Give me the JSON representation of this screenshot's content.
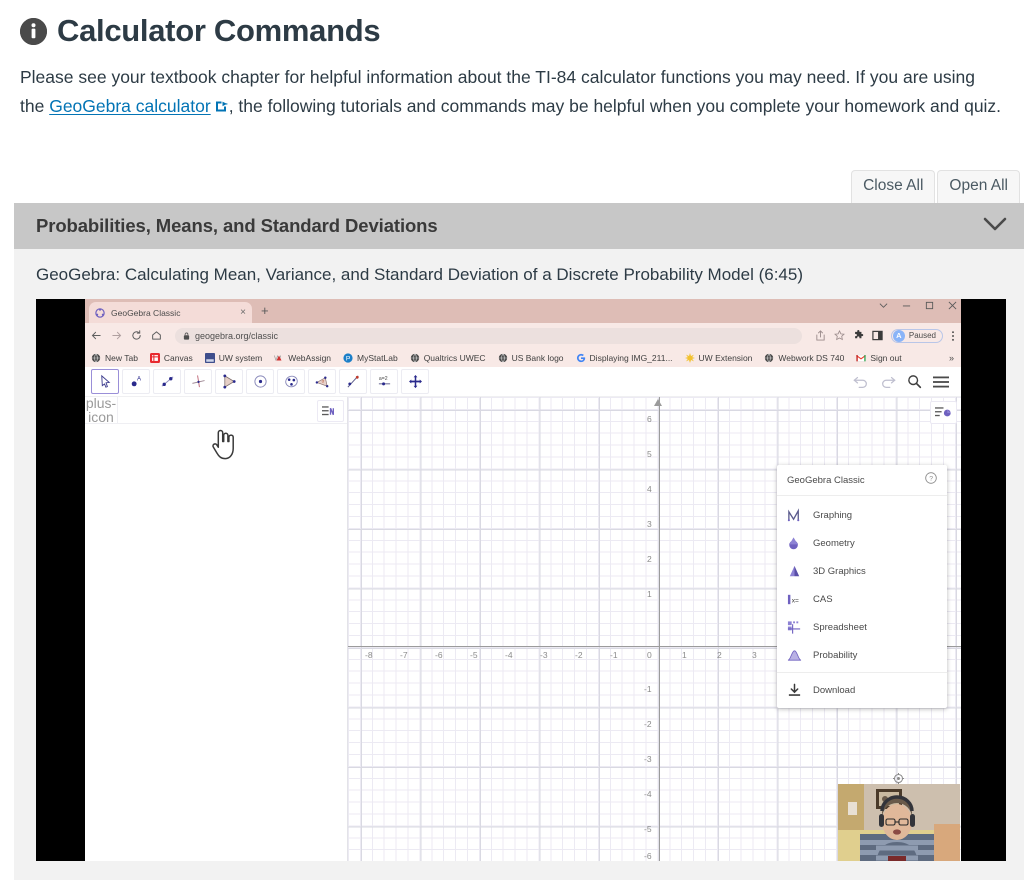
{
  "header": {
    "icon": "info-circle-icon",
    "title": "Calculator Commands",
    "intro_before_link": "Please see your textbook chapter for helpful information about the TI-84 calculator functions you may need. If you are using the ",
    "link_text": "GeoGebra calculator",
    "link_icon": "external-link-icon",
    "intro_after_link": ", the following tutorials and commands may be helpful when you complete your homework and quiz."
  },
  "toolbar": {
    "close_all_label": "Close All",
    "open_all_label": "Open All"
  },
  "accordion": {
    "title": "Probabilities, Means, and Standard Deviations",
    "chevron": "chevron-down-icon",
    "expanded": true,
    "caption": "GeoGebra: Calculating Mean, Variance, and Standard Deviation of a Discrete Probability Model (6:45)",
    "duration": "6:45"
  },
  "video": {
    "browser": {
      "tab_title": "GeoGebra Classic",
      "tab_favicon": "geogebra-icon",
      "tab_close": "close-icon",
      "new_tab": "+",
      "window_controls": [
        "chevron-down-icon",
        "minimize-icon",
        "maximize-icon",
        "close-icon"
      ],
      "nav": {
        "back": "back-arrow-icon",
        "forward": "forward-arrow-icon",
        "reload": "reload-icon",
        "home": "home-icon"
      },
      "omnibox": {
        "lock_icon": "lock-icon",
        "url": "geogebra.org/classic"
      },
      "right_icons": [
        "share-icon",
        "star-icon",
        "extensions-puzzle-icon",
        "sidepanel-icon"
      ],
      "profile": {
        "initial": "A",
        "status": "Paused"
      },
      "menu_icon": "three-dot-menu-icon",
      "bookmarks": [
        {
          "label": "New Tab",
          "icon": "globe-icon"
        },
        {
          "label": "Canvas",
          "icon": "canvas-icon"
        },
        {
          "label": "UW system",
          "icon": "uw-icon"
        },
        {
          "label": "WebAssign",
          "icon": "webassign-icon"
        },
        {
          "label": "MyStatLab",
          "icon": "mystatlab-icon"
        },
        {
          "label": "Qualtrics UWEC",
          "icon": "globe-icon"
        },
        {
          "label": "US Bank logo",
          "icon": "globe-icon"
        },
        {
          "label": "Displaying IMG_211...",
          "icon": "google-icon"
        },
        {
          "label": "UW Extension",
          "icon": "star-burst-icon"
        },
        {
          "label": "Webwork DS 740",
          "icon": "globe-icon"
        },
        {
          "label": "Sign out",
          "icon": "gmail-icon"
        }
      ],
      "bookmarks_overflow": "»"
    },
    "geogebra": {
      "tools": [
        "move-tool-icon",
        "point-tool-icon",
        "line-tool-icon",
        "perpendicular-line-tool-icon",
        "polygon-tool-icon",
        "circle-tool-icon",
        "ellipse-tool-icon",
        "angle-tool-icon",
        "reflect-tool-icon",
        "slider-tool-icon",
        "move-graphics-tool-icon"
      ],
      "tool_right_icons": [
        "undo-icon",
        "redo-icon",
        "search-icon",
        "hamburger-menu-icon"
      ],
      "algebra_panel": {
        "add_icon": "plus-icon",
        "toggle_icon": "algebra-view-icon",
        "cursor": "pointing-hand-cursor"
      },
      "graphics": {
        "style_bar_icon": "style-bar-icon",
        "x_ticks": [
          "-8",
          "-7",
          "-6",
          "-5",
          "-4",
          "-3",
          "-2",
          "-1",
          "0",
          "1",
          "2",
          "3"
        ],
        "y_ticks": [
          "6",
          "5",
          "4",
          "3",
          "2",
          "1",
          "-1",
          "-2",
          "-3",
          "-4",
          "-5",
          "-6"
        ]
      },
      "perspectives": {
        "title": "GeoGebra Classic",
        "help_icon": "help-circle-icon",
        "items": [
          {
            "label": "Graphing",
            "icon": "graphing-icon"
          },
          {
            "label": "Geometry",
            "icon": "geometry-icon"
          },
          {
            "label": "3D Graphics",
            "icon": "3d-graphics-icon"
          },
          {
            "label": "CAS",
            "icon": "cas-icon"
          },
          {
            "label": "Spreadsheet",
            "icon": "spreadsheet-icon"
          },
          {
            "label": "Probability",
            "icon": "probability-icon"
          }
        ],
        "download": {
          "label": "Download",
          "icon": "download-icon"
        }
      }
    },
    "webcam_overlay": "presenter-webcam",
    "zoom_control_icon": "zoom-target-icon"
  },
  "colors": {
    "link": "#0374b5",
    "accordion_header": "#c7c7c7",
    "accordion_body": "#f2f2f2",
    "text": "#2d3b45",
    "browser_chrome": "#f8e9e6",
    "geogebra_purple": "#6f61c0"
  }
}
